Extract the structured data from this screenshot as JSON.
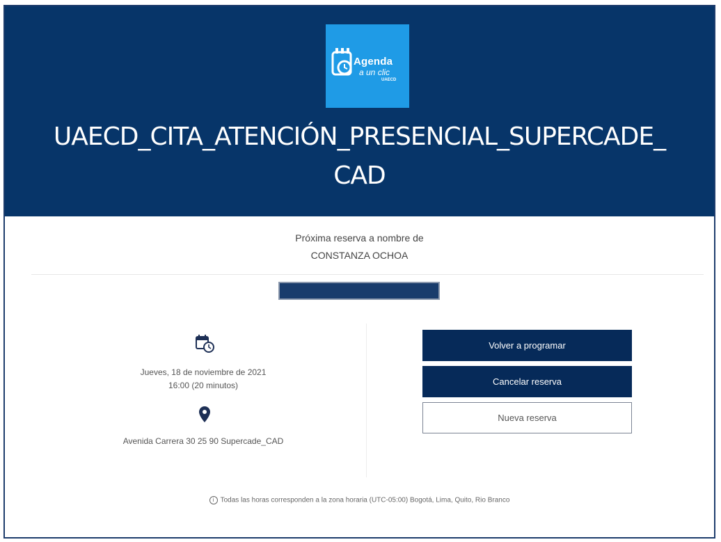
{
  "header": {
    "logo": {
      "title": "Agenda",
      "subtitle": "a un clic",
      "org": "UAECD"
    },
    "title_line1": "UAECD_CITA_ATENCIÓN_PRESENCIAL_SUPERCADE_",
    "title_line2": "CAD"
  },
  "booking": {
    "label": "Próxima reserva a nombre de",
    "name": "CONSTANZA OCHOA",
    "date": "Jueves, 18 de noviembre de 2021",
    "time": "16:00 (20 minutos)",
    "address": "Avenida Carrera 30 25 90 Supercade_CAD"
  },
  "actions": {
    "reschedule": "Volver a programar",
    "cancel": "Cancelar reserva",
    "new": "Nueva reserva"
  },
  "footer": {
    "timezone_note": "Todas las horas corresponden a la zona horaria (UTC-05:00) Bogotá, Lima, Quito, Rio Branco"
  },
  "icons": {
    "calendar": "calendar-clock-icon",
    "location": "map-pin-icon",
    "info": "info-icon"
  },
  "colors": {
    "header_bg": "#073569",
    "logo_bg": "#1f9be6",
    "button_dark": "#062a59"
  }
}
